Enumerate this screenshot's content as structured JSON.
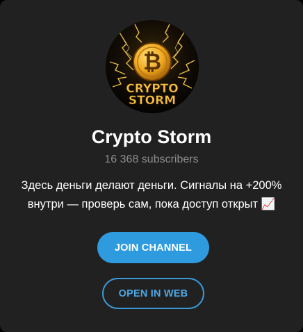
{
  "channel": {
    "logo_line1": "CRYPTO",
    "logo_line2": "STORM",
    "logo_symbol": "₿",
    "title": "Crypto Storm",
    "subscribers": "16 368 subscribers",
    "description": "Здесь деньги делают деньги. Сигналы на +200% внутри — проверь сам, пока доступ открыт 📈"
  },
  "actions": {
    "join_label": "JOIN CHANNEL",
    "web_label": "OPEN IN WEB"
  },
  "colors": {
    "card_bg": "#212121",
    "accent": "#2f9bdf",
    "muted_text": "#8d8d8d",
    "gold": "#f3b72a"
  }
}
